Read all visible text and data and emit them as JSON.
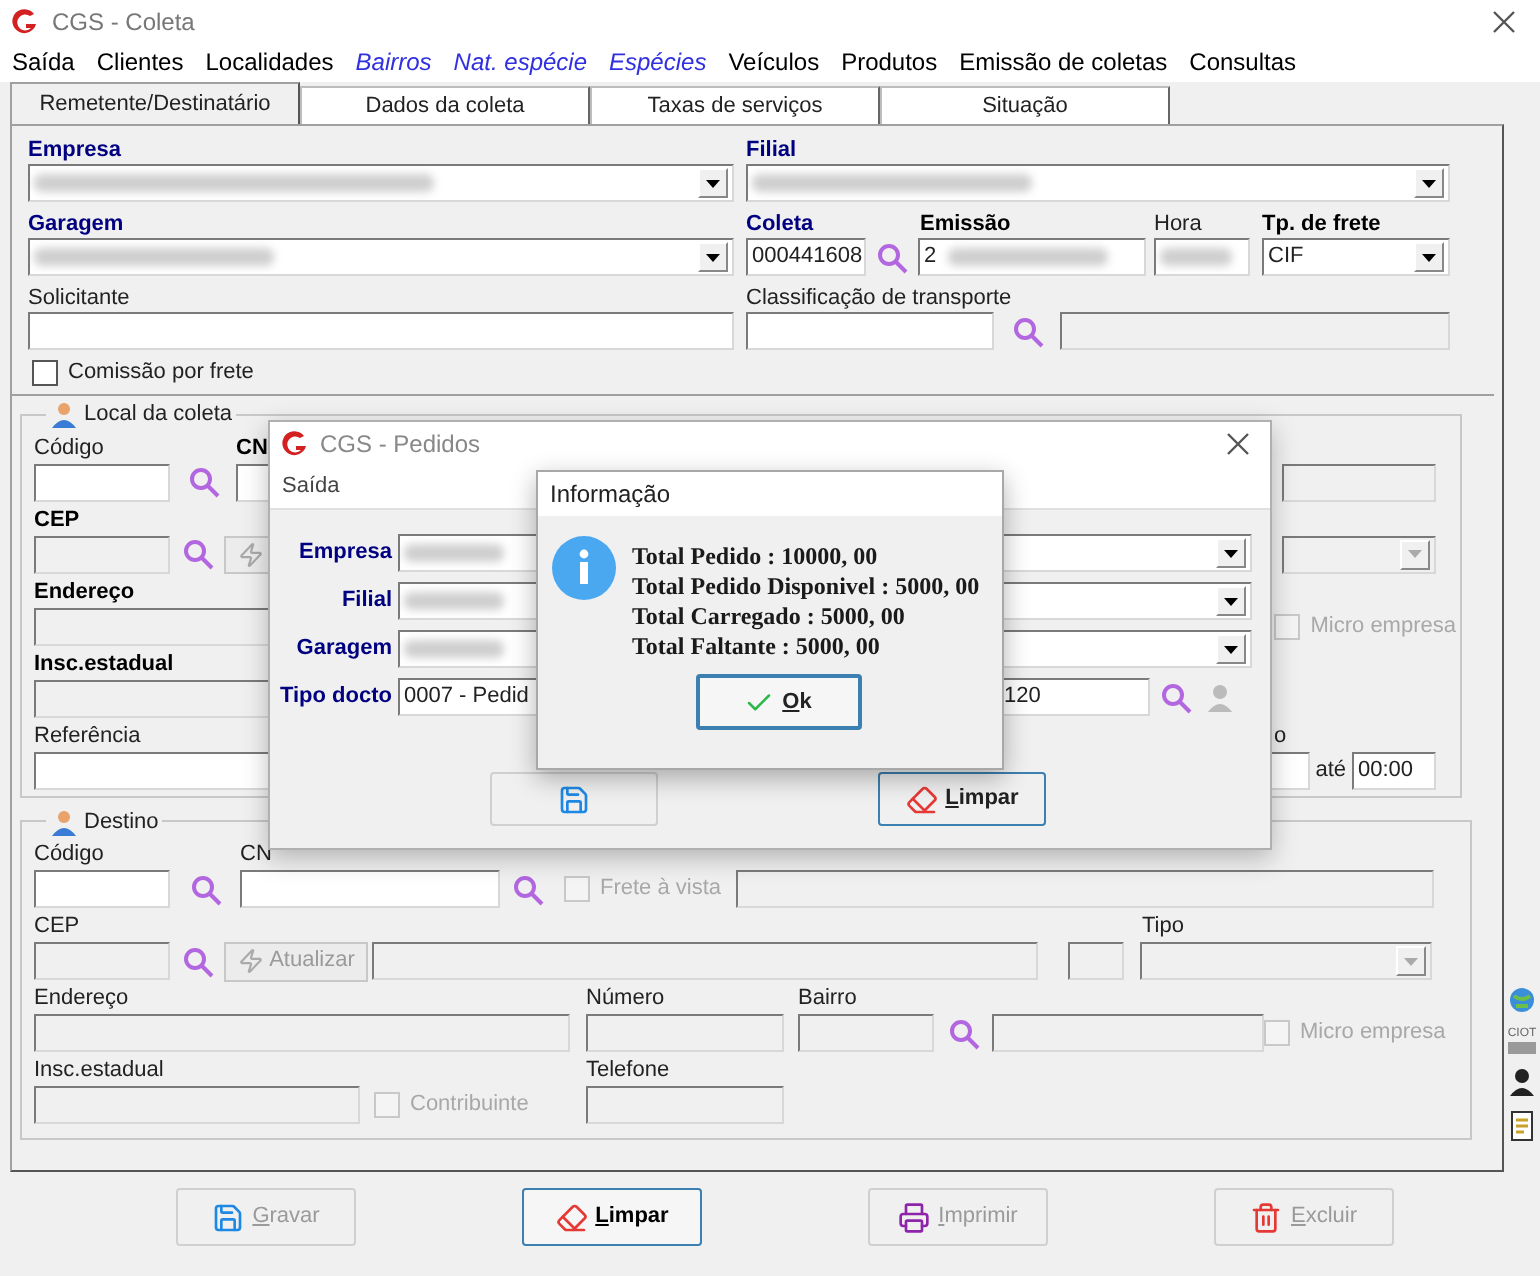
{
  "window": {
    "title": "CGS - Coleta"
  },
  "menu": [
    {
      "label": "Saída",
      "kind": "menu"
    },
    {
      "label": "Clientes",
      "kind": "menu"
    },
    {
      "label": "Localidades",
      "kind": "menu"
    },
    {
      "label": "Bairros",
      "kind": "link"
    },
    {
      "label": "Nat. espécie",
      "kind": "link"
    },
    {
      "label": "Espécies",
      "kind": "link"
    },
    {
      "label": "Veículos",
      "kind": "menu"
    },
    {
      "label": "Produtos",
      "kind": "menu"
    },
    {
      "label": "Emissão de coletas",
      "kind": "menu"
    },
    {
      "label": "Consultas",
      "kind": "menu"
    }
  ],
  "tabs": [
    {
      "label": "Remetente/Destinatário",
      "selected": true
    },
    {
      "label": "Dados da coleta",
      "selected": false
    },
    {
      "label": "Taxas de serviços",
      "selected": false
    },
    {
      "label": "Situação",
      "selected": false
    }
  ],
  "header": {
    "empresa": {
      "label": "Empresa",
      "disabled": false
    },
    "filial": {
      "label": "Filial",
      "disabled": false
    },
    "garagem": {
      "label": "Garagem",
      "disabled": false
    },
    "coleta": {
      "label": "Coleta",
      "value": "000441608",
      "disabled": false
    },
    "emissao": {
      "label": "Emissão",
      "value": "2",
      "disabled": false
    },
    "hora": {
      "label": "Hora",
      "disabled": false
    },
    "tipo_frete": {
      "label": "Tp. de frete",
      "value": "CIF",
      "disabled": false
    },
    "solicitante": {
      "label": "Solicitante",
      "disabled": false
    },
    "classificacao": {
      "label": "Classificação de transporte",
      "disabled": false
    },
    "classificacao_descricao": {
      "disabled": true
    },
    "comissao": {
      "label": "Comissão por frete",
      "checked": false,
      "disabled": false
    }
  },
  "local_coleta": {
    "title": "Local da coleta",
    "codigo": {
      "label": "Código",
      "disabled": false
    },
    "cn": {
      "label": "CN",
      "disabled": false
    },
    "nome": {
      "disabled": true
    },
    "cep": {
      "label": "CEP",
      "disabled": true
    },
    "tipo": {
      "disabled": true
    },
    "endereco": {
      "label": "Endereço",
      "disabled": true
    },
    "micro": {
      "label": "Micro empresa",
      "checked": false,
      "disabled": true
    },
    "insc": {
      "label": "Insc.estadual",
      "disabled": true
    },
    "referencia": {
      "label": "Referência",
      "disabled": false
    },
    "label_fragment": "o",
    "hora_de": {
      "disabled": false
    },
    "ate": {
      "label": "até",
      "value": "00:00",
      "disabled": false
    }
  },
  "destino": {
    "title": "Destino",
    "codigo": {
      "label": "Código",
      "disabled": false
    },
    "cn": {
      "label": "CN",
      "disabled": false
    },
    "frete_vista": {
      "label": "Frete à vista",
      "checked": false,
      "disabled": true
    },
    "nome": {
      "disabled": true
    },
    "cep": {
      "label": "CEP",
      "disabled": true
    },
    "atualizar": {
      "label": "Atualizar",
      "disabled": true
    },
    "cidade": {
      "disabled": true
    },
    "uf": {
      "disabled": true
    },
    "tipo": {
      "label": "Tipo",
      "disabled": true
    },
    "endereco": {
      "label": "Endereço",
      "disabled": true
    },
    "numero": {
      "label": "Número",
      "disabled": true
    },
    "bairro": {
      "label": "Bairro",
      "disabled": true
    },
    "bairro_nome": {
      "disabled": true
    },
    "micro": {
      "label": "Micro empresa",
      "checked": false,
      "disabled": true
    },
    "insc": {
      "label": "Insc.estadual",
      "disabled": true
    },
    "contribuinte": {
      "label": "Contribuinte",
      "checked": false,
      "disabled": true
    },
    "telefone": {
      "label": "Telefone",
      "disabled": true
    }
  },
  "side_tools": [
    {
      "kind": "globe"
    },
    {
      "kind": "ciot",
      "label": "CIOT"
    },
    {
      "kind": "person"
    },
    {
      "kind": "document"
    }
  ],
  "bottom_buttons": [
    {
      "label": "Gravar",
      "kind": "save",
      "disabled": true,
      "focused": false
    },
    {
      "label": "Limpar",
      "kind": "erase",
      "disabled": false,
      "focused": true
    },
    {
      "label": "Imprimir",
      "kind": "print",
      "disabled": true,
      "focused": false
    },
    {
      "label": "Excluir",
      "kind": "delete",
      "disabled": true,
      "focused": false
    }
  ],
  "pedidos_dialog": {
    "title": "CGS - Pedidos",
    "menu": [
      "Saída"
    ],
    "fields": [
      {
        "label": "Empresa",
        "kind": "combo"
      },
      {
        "label": "Filial",
        "kind": "combo"
      },
      {
        "label": "Garagem",
        "kind": "combo"
      },
      {
        "label": "Tipo docto",
        "kind": "lookup",
        "value": "0007 - Pedid",
        "number": "120"
      }
    ],
    "buttons": [
      {
        "kind": "save"
      },
      {
        "kind": "erase",
        "label": "Limpar"
      }
    ]
  },
  "info_dialog": {
    "title": "Informação",
    "lines": [
      "Total Pedido : 10000, 00",
      "Total Pedido Disponivel : 5000, 00",
      "Total Carregado : 5000, 00",
      "Total Faltante : 5000, 00"
    ],
    "button": "Ok"
  }
}
